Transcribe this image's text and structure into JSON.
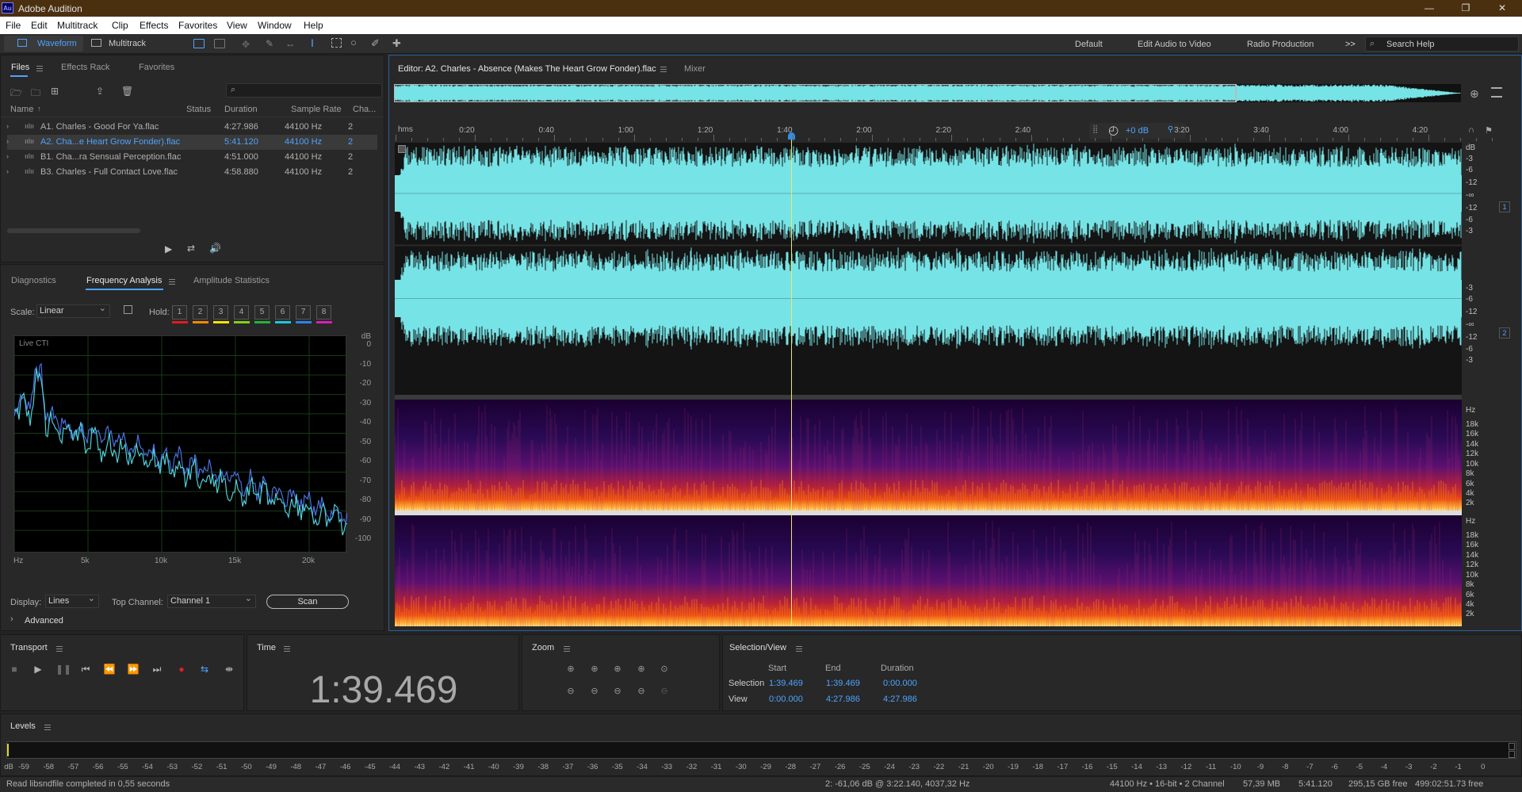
{
  "app": {
    "title": "Adobe Audition",
    "logo": "Au"
  },
  "menu": [
    "File",
    "Edit",
    "Multitrack",
    "Clip",
    "Effects",
    "Favorites",
    "View",
    "Window",
    "Help"
  ],
  "toolbar": {
    "waveform": "Waveform",
    "multitrack": "Multitrack",
    "workspaces": [
      "Default",
      "Edit Audio to Video",
      "Radio Production"
    ],
    "more": ">>",
    "search_placeholder": "Search Help"
  },
  "files_panel": {
    "tabs": [
      "Files",
      "Effects Rack",
      "Favorites"
    ],
    "columns": [
      "Name",
      "Status",
      "Duration",
      "Sample Rate",
      "Cha..."
    ],
    "rows": [
      {
        "name": "A1. Charles - Good For Ya.flac",
        "duration": "4:27.986",
        "rate": "44100 Hz",
        "ch": "2",
        "selected": false
      },
      {
        "name": "A2. Cha...e Heart Grow Fonder).flac",
        "duration": "5:41.120",
        "rate": "44100 Hz",
        "ch": "2",
        "selected": true
      },
      {
        "name": "B1. Cha...ra Sensual Perception.flac",
        "duration": "4:51.000",
        "rate": "44100 Hz",
        "ch": "2",
        "selected": false
      },
      {
        "name": "B3. Charles - Full Contact Love.flac",
        "duration": "4:58.880",
        "rate": "44100 Hz",
        "ch": "2",
        "selected": false
      }
    ]
  },
  "analysis_panel": {
    "tabs": [
      "Diagnostics",
      "Frequency Analysis",
      "Amplitude Statistics"
    ],
    "scale_label": "Scale:",
    "scale_value": "Linear",
    "hold_label": "Hold:",
    "holds": [
      "1",
      "2",
      "3",
      "4",
      "5",
      "6",
      "7",
      "8"
    ],
    "hold_colors": [
      "#e01b24",
      "#f08a00",
      "#f2e400",
      "#7fd01f",
      "#20b43a",
      "#19c6e0",
      "#2a84e8",
      "#d51fb8"
    ],
    "live_cti": "Live CTI",
    "db_unit": "dB",
    "db_ticks": [
      "0",
      "-10",
      "-20",
      "-30",
      "-40",
      "-50",
      "-60",
      "-70",
      "-80",
      "-90",
      "-100"
    ],
    "freq_ticks": [
      "Hz",
      "5k",
      "10k",
      "15k",
      "20k"
    ],
    "display_label": "Display:",
    "display_value": "Lines",
    "top_channel_label": "Top Channel:",
    "top_channel_value": "Channel 1",
    "scan": "Scan",
    "advanced": "Advanced"
  },
  "editor": {
    "tab_title": "Editor: A2. Charles - Absence (Makes The Heart Grow Fonder).flac",
    "mixer_tab": "Mixer",
    "ruler_unit": "hms",
    "ruler_ticks": [
      "0:20",
      "0:40",
      "1:00",
      "1:20",
      "1:40",
      "2:00",
      "2:20",
      "2:40",
      "3:00",
      "3:20",
      "3:40",
      "4:00",
      "4:20"
    ],
    "volume": "+0 dB",
    "db_scale_ch": [
      "dB",
      "-3",
      "-6",
      "-12",
      "-∞",
      "-12",
      "-6",
      "-3"
    ],
    "db_scale_ch2": [
      "-3",
      "-6",
      "-12",
      "-∞",
      "-12",
      "-6",
      "-3"
    ],
    "channels": [
      "1",
      "2"
    ],
    "hz_scale": [
      "Hz",
      "18k",
      "16k",
      "14k",
      "12k",
      "10k",
      "8k",
      "6k",
      "4k",
      "2k"
    ],
    "colors": {
      "waveform": "#76e3e6",
      "cti": "#e8e870",
      "selection_blue": "#2f8ee6"
    }
  },
  "transport": {
    "label": "Transport"
  },
  "time": {
    "label": "Time",
    "value": "1:39.469"
  },
  "zoom": {
    "label": "Zoom"
  },
  "selection_view": {
    "label": "Selection/View",
    "headers": [
      "Start",
      "End",
      "Duration"
    ],
    "rows": [
      {
        "label": "Selection",
        "start": "1:39.469",
        "end": "1:39.469",
        "duration": "0:00.000"
      },
      {
        "label": "View",
        "start": "0:00.000",
        "end": "4:27.986",
        "duration": "4:27.986"
      }
    ]
  },
  "levels": {
    "label": "Levels",
    "ticks": [
      "dB",
      "-59",
      "-58",
      "-57",
      "-56",
      "-55",
      "-54",
      "-53",
      "-52",
      "-51",
      "-50",
      "-49",
      "-48",
      "-47",
      "-46",
      "-45",
      "-44",
      "-43",
      "-42",
      "-41",
      "-40",
      "-39",
      "-38",
      "-37",
      "-36",
      "-35",
      "-34",
      "-33",
      "-32",
      "-31",
      "-30",
      "-29",
      "-28",
      "-27",
      "-26",
      "-25",
      "-24",
      "-23",
      "-22",
      "-21",
      "-20",
      "-19",
      "-18",
      "-17",
      "-16",
      "-15",
      "-14",
      "-13",
      "-12",
      "-11",
      "-10",
      "-9",
      "-8",
      "-7",
      "-6",
      "-5",
      "-4",
      "-3",
      "-2",
      "-1",
      "0"
    ]
  },
  "status": {
    "message": "Read libsndfile completed in 0,55 seconds",
    "cursor": "2: -61,06 dB @ 3:22.140, 4037,32 Hz",
    "format": "44100 Hz • 16-bit • 2 Channel",
    "size": "57,39 MB",
    "duration": "5:41.120",
    "free": "295,15 GB free",
    "free_time": "499:02:51.73 free"
  }
}
